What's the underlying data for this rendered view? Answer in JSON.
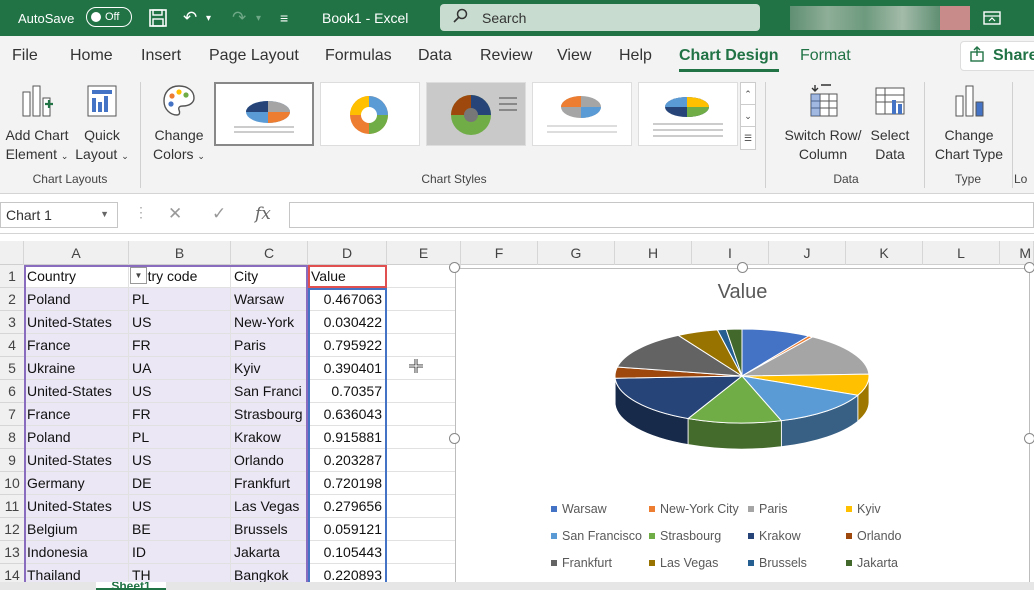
{
  "titlebar": {
    "autosave_label": "AutoSave",
    "autosave_state": "Off",
    "doc_title": "Book1  -  Excel",
    "search_placeholder": "Search"
  },
  "tabs": [
    "File",
    "Home",
    "Insert",
    "Page Layout",
    "Formulas",
    "Data",
    "Review",
    "View",
    "Help",
    "Chart Design",
    "Format"
  ],
  "active_tab": "Chart Design",
  "share_label": "Share",
  "ribbon": {
    "add_chart_element": [
      "Add Chart",
      "Element"
    ],
    "quick_layout": [
      "Quick",
      "Layout"
    ],
    "change_colors": [
      "Change",
      "Colors"
    ],
    "switch_row_col": [
      "Switch Row/",
      "Column"
    ],
    "select_data": [
      "Select",
      "Data"
    ],
    "change_chart_type": [
      "Change",
      "Chart Type"
    ],
    "groups": {
      "chart_layouts": "Chart Layouts",
      "chart_styles": "Chart Styles",
      "data": "Data",
      "type": "Type",
      "lo": "Lo"
    }
  },
  "formula_bar": {
    "name_box": "Chart 1",
    "fx": "fx",
    "cancel": "✕",
    "enter": "✓"
  },
  "columns": [
    "A",
    "B",
    "C",
    "D",
    "E",
    "F",
    "G",
    "H",
    "I",
    "J",
    "K",
    "L",
    "M"
  ],
  "rows": [
    "1",
    "2",
    "3",
    "4",
    "5",
    "6",
    "7",
    "8",
    "9",
    "10",
    "11",
    "12",
    "13",
    "14"
  ],
  "table": {
    "headers": [
      "Country",
      "untry code",
      "City",
      "Value"
    ],
    "data": [
      [
        "Poland",
        "PL",
        "Warsaw",
        "0.467063"
      ],
      [
        "United-States",
        "US",
        "New-York",
        "0.030422"
      ],
      [
        "France",
        "FR",
        "Paris",
        "0.795922"
      ],
      [
        "Ukraine",
        "UA",
        "Kyiv",
        "0.390401"
      ],
      [
        "United-States",
        "US",
        "San Franci",
        "0.70357"
      ],
      [
        "France",
        "FR",
        "Strasbourg",
        "0.636043"
      ],
      [
        "Poland",
        "PL",
        "Krakow",
        "0.915881"
      ],
      [
        "United-States",
        "US",
        "Orlando",
        "0.203287"
      ],
      [
        "Germany",
        "DE",
        "Frankfurt",
        "0.720198"
      ],
      [
        "United-States",
        "US",
        "Las Vegas",
        "0.279656"
      ],
      [
        "Belgium",
        "BE",
        "Brussels",
        "0.059121"
      ],
      [
        "Indonesia",
        "ID",
        "Jakarta",
        "0.105443"
      ],
      [
        "Thailand",
        "TH",
        "Bangkok",
        "0.220893"
      ]
    ]
  },
  "sheet_tab": "Sheet1",
  "chart_data": {
    "type": "pie",
    "title": "Value",
    "legend_position": "bottom",
    "categories": [
      "Warsaw",
      "New-York City",
      "Paris",
      "Kyiv",
      "San Francisco",
      "Strasbourg",
      "Krakow",
      "Orlando",
      "Frankfurt",
      "Las Vegas",
      "Brussels",
      "Jakarta"
    ],
    "values": [
      0.467063,
      0.030422,
      0.795922,
      0.390401,
      0.70357,
      0.636043,
      0.915881,
      0.203287,
      0.720198,
      0.279656,
      0.059121,
      0.105443
    ],
    "colors": [
      "#4472C4",
      "#ED7D31",
      "#A5A5A5",
      "#FFC000",
      "#5B9BD5",
      "#70AD47",
      "#264478",
      "#9E480E",
      "#636363",
      "#997300",
      "#255E91",
      "#43682B"
    ]
  }
}
